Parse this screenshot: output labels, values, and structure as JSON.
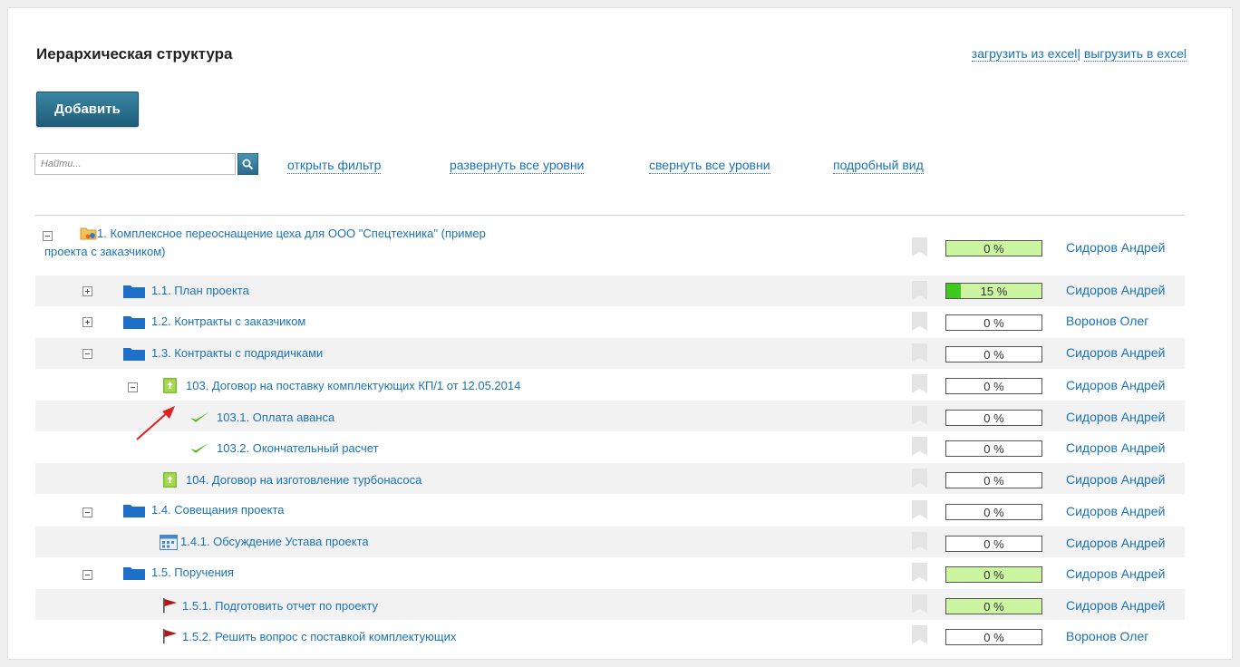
{
  "header": {
    "title": "Иерархическая структура",
    "load_excel": "загрузить из excel",
    "separator": "|",
    "export_excel": "выгрузить в excel"
  },
  "toolbar": {
    "add_label": "Добавить",
    "search_placeholder": "Найти...",
    "search_icon": "magnifier-icon",
    "open_filter": "открыть фильтр",
    "expand_all": "развернуть все уровни",
    "collapse_all": "свернуть все уровни",
    "detailed_view": "подробный вид"
  },
  "colors": {
    "link": "#1a73b8",
    "progress_green_bg": "#ccf5a2",
    "progress_fill": "#41c81f",
    "folder": "#1d6fc8",
    "flag": "#b01818",
    "check": "#5cb82b"
  },
  "rows": [
    {
      "label": "1. Комплексное переоснащение цеха для ООО \"Спецтехника\" (пример",
      "label2": "проекта с заказчиком)",
      "progress": "0 %",
      "progress_value": 0,
      "owner": "Сидоров Андрей",
      "icon": "project-folder-icon",
      "toggle": "collapse"
    },
    {
      "label": "1.1. План проекта",
      "progress": "15 %",
      "progress_value": 15,
      "owner": "Сидоров Андрей",
      "icon": "folder-icon",
      "toggle": "expand"
    },
    {
      "label": "1.2. Контракты с заказчиком",
      "progress": "0 %",
      "progress_value": 0,
      "owner": "Воронов Олег",
      "icon": "folder-icon",
      "toggle": "expand"
    },
    {
      "label": "1.3. Контракты с подрядичками",
      "progress": "0 %",
      "progress_value": 0,
      "owner": "Сидоров Андрей",
      "icon": "folder-icon",
      "toggle": "collapse"
    },
    {
      "label": "103. Договор на поставку комплектующих КП/1 от 12.05.2014",
      "progress": "0 %",
      "progress_value": 0,
      "owner": "Сидоров Андрей",
      "icon": "contract-icon",
      "toggle": "collapse"
    },
    {
      "label": "103.1. Оплата аванса",
      "progress": "0 %",
      "progress_value": 0,
      "owner": "Сидоров Андрей",
      "icon": "checkmark-icon"
    },
    {
      "label": "103.2. Окончательный расчет",
      "progress": "0 %",
      "progress_value": 0,
      "owner": "Сидоров Андрей",
      "icon": "checkmark-icon"
    },
    {
      "label": "104. Договор на изготовление турбонасоса",
      "progress": "0 %",
      "progress_value": 0,
      "owner": "Сидоров Андрей",
      "icon": "contract-icon"
    },
    {
      "label": "1.4. Совещания проекта",
      "progress": "0 %",
      "progress_value": 0,
      "owner": "Сидоров Андрей",
      "icon": "folder-icon",
      "toggle": "collapse"
    },
    {
      "label": "1.4.1. Обсуждение Устава проекта",
      "progress": "0 %",
      "progress_value": 0,
      "owner": "Сидоров Андрей",
      "icon": "calendar-icon"
    },
    {
      "label": "1.5. Поручения",
      "progress": "0 %",
      "progress_value": 0,
      "owner": "Сидоров Андрей",
      "icon": "folder-icon",
      "toggle": "collapse"
    },
    {
      "label": "1.5.1. Подготовить отчет по проекту",
      "progress": "0 %",
      "progress_value": 0,
      "owner": "Сидоров Андрей",
      "icon": "flag-icon"
    },
    {
      "label": "1.5.2. Решить вопрос с поставкой комплектующих",
      "progress": "0 %",
      "progress_value": 0,
      "owner": "Воронов Олег",
      "icon": "flag-icon"
    }
  ]
}
